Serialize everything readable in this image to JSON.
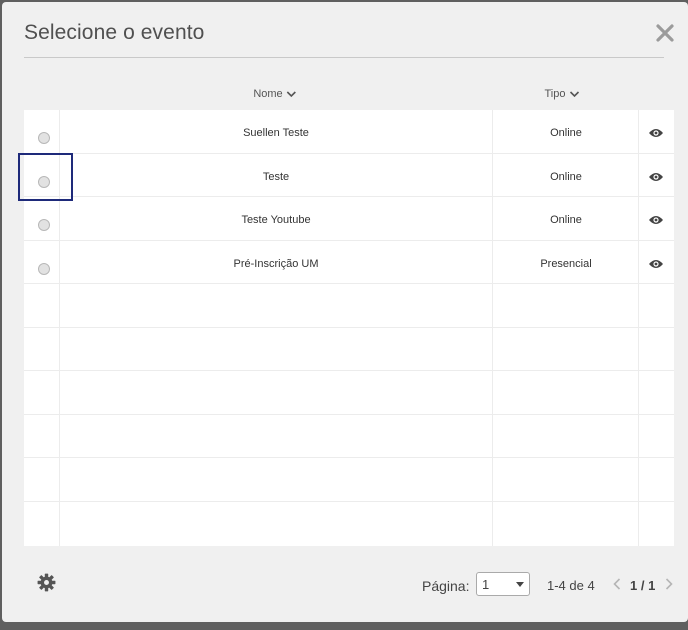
{
  "dialog": {
    "title": "Selecione o evento"
  },
  "table": {
    "columns": [
      {
        "label": "Nome"
      },
      {
        "label": "Tipo"
      }
    ],
    "rows": [
      {
        "nome": "Suellen Teste",
        "tipo": "Online"
      },
      {
        "nome": "Teste",
        "tipo": "Online"
      },
      {
        "nome": "Teste Youtube",
        "tipo": "Online"
      },
      {
        "nome": "Pré-Inscrição UM",
        "tipo": "Presencial"
      }
    ]
  },
  "pagination": {
    "label": "Página:",
    "page_select": "1",
    "range": "1-4 de 4",
    "pages": "1 / 1"
  },
  "icons": [
    "close-icon",
    "chevron-down-icon",
    "eye-icon",
    "gear-icon",
    "chevron-left-icon",
    "chevron-right-icon"
  ],
  "colors": {
    "highlight": "#1e2a7a",
    "background": "#f0f0f0"
  }
}
